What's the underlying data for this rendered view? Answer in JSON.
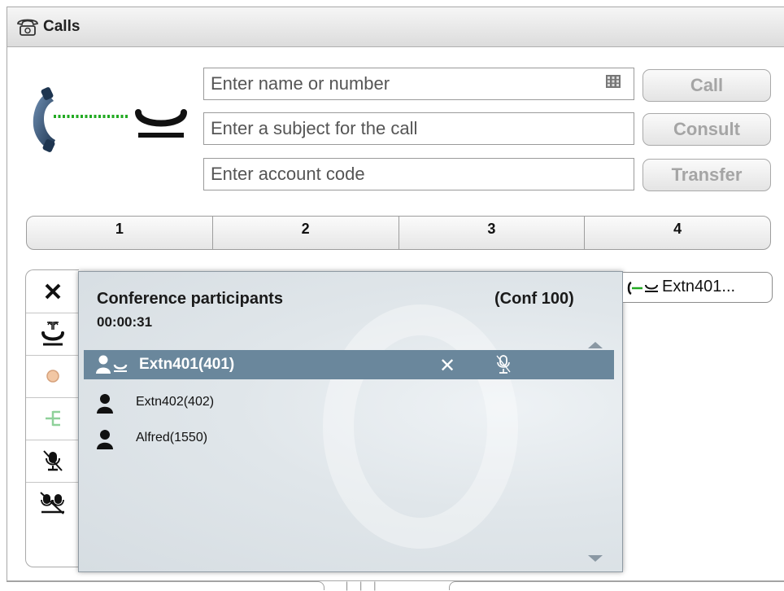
{
  "window": {
    "title": "Calls"
  },
  "dial": {
    "number_placeholder": "Enter name or number",
    "subject_placeholder": "Enter a subject for the call",
    "account_placeholder": "Enter account code",
    "call_label": "Call",
    "consult_label": "Consult",
    "transfer_label": "Transfer"
  },
  "tabs": [
    {
      "label": "1"
    },
    {
      "label": "2"
    },
    {
      "label": "3"
    },
    {
      "label": "4"
    }
  ],
  "sidebar": {
    "items": [
      {
        "icon": "close-icon"
      },
      {
        "icon": "hold-icon"
      },
      {
        "icon": "record-icon"
      },
      {
        "icon": "conference-tree-icon"
      },
      {
        "icon": "mute-icon"
      },
      {
        "icon": "group-mute-icon"
      }
    ]
  },
  "conference": {
    "title": "Conference participants",
    "conf_id": "(Conf 100)",
    "timer": "00:00:31",
    "participants": [
      {
        "name": "Extn401(401)",
        "selected": true
      },
      {
        "name": "Extn402(402)",
        "selected": false
      },
      {
        "name": "Alfred(1550)",
        "selected": false
      }
    ]
  },
  "call_tag": {
    "label": "Extn401..."
  },
  "colors": {
    "selected_row": "#6a879c",
    "connection_green": "#22aa22",
    "disabled_button_text": "#a5a5a5"
  }
}
